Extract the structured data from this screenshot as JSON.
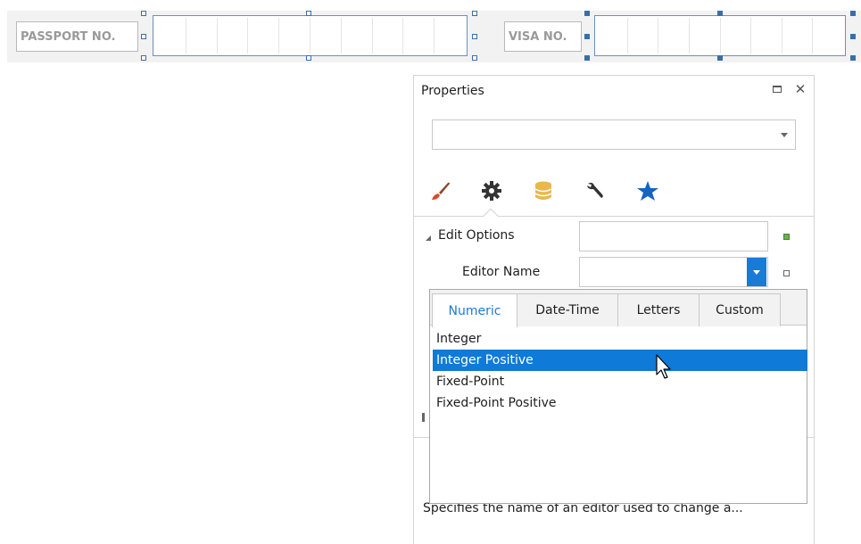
{
  "designer": {
    "passport_label": "PASSPORT NO.",
    "visa_label": "VISA NO.",
    "passport_cell_count": 10,
    "visa_cell_count": 8
  },
  "properties_panel": {
    "title": "Properties",
    "object_selector_value": "",
    "category_tabs": [
      {
        "name": "appearance",
        "icon": "paintbrush-icon"
      },
      {
        "name": "behavior",
        "icon": "gear-icon"
      },
      {
        "name": "data",
        "icon": "database-icon"
      },
      {
        "name": "tools",
        "icon": "wrench-icon"
      },
      {
        "name": "favorites",
        "icon": "star-icon"
      }
    ],
    "rows": {
      "edit_options_label": "Edit Options",
      "editor_name_label": "Editor Name",
      "editor_name_value": ""
    },
    "description": "Specifies the name of an editor used to change a..."
  },
  "editor_dropdown": {
    "tabs": [
      "Numeric",
      "Date-Time",
      "Letters",
      "Custom"
    ],
    "active_tab": "Numeric",
    "items": [
      "Integer",
      "Integer Positive",
      "Fixed-Point",
      "Fixed-Point Positive"
    ],
    "selected_item": "Integer Positive"
  },
  "colors": {
    "accent": "#1a7bd6",
    "selection": "#0f7ad7",
    "handle": "#3b6ea5",
    "star": "#1565c0",
    "brush_handle": "#d84a2a",
    "database": "#e8b84a"
  }
}
